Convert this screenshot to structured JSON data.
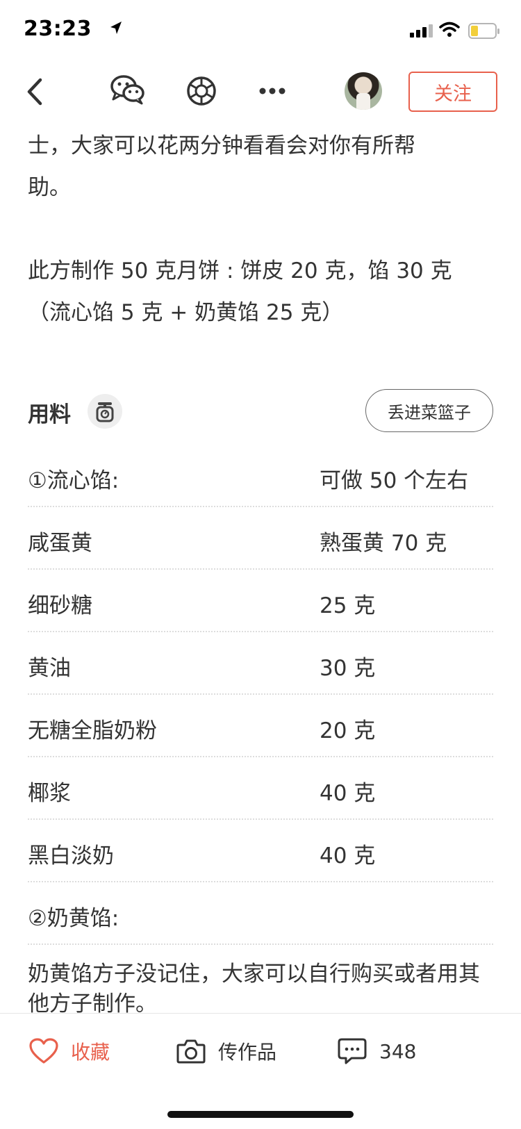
{
  "status_bar": {
    "time": "23:23"
  },
  "nav": {
    "follow_label": "关注"
  },
  "content": {
    "intro_line1": "士，大家可以花两分钟看看会对你有所帮",
    "intro_line2": "助。",
    "portion_line1": "此方制作 50 克月饼 : 饼皮 20 克，馅 30 克",
    "portion_line2": "（流心馅 5 克 + 奶黄馅 25 克）"
  },
  "ingredients": {
    "title": "用料",
    "basket_label": "丢进菜篮子",
    "rows": [
      {
        "name": "①流心馅:",
        "amount": "可做 50 个左右"
      },
      {
        "name": "咸蛋黄",
        "amount": "熟蛋黄 70 克"
      },
      {
        "name": "细砂糖",
        "amount": "25 克"
      },
      {
        "name": "黄油",
        "amount": "30 克"
      },
      {
        "name": "无糖全脂奶粉",
        "amount": "20 克"
      },
      {
        "name": "椰浆",
        "amount": "40 克"
      },
      {
        "name": "黑白淡奶",
        "amount": "40 克"
      },
      {
        "name": "②奶黄馅:",
        "amount": ""
      }
    ],
    "note": "奶黄馅方子没记住，大家可以自行购买或者用其他方子制作。"
  },
  "bottom_bar": {
    "favorite_label": "收藏",
    "upload_label": "传作品",
    "comment_count": "348"
  },
  "colors": {
    "accent": "#e8604c",
    "text": "#333333",
    "divider": "#dddddd"
  },
  "icons": [
    "location-arrow-icon",
    "signal-icon",
    "wifi-icon",
    "battery-icon",
    "back-icon",
    "wechat-icon",
    "moments-icon",
    "more-icon",
    "scale-icon",
    "heart-icon",
    "camera-icon",
    "comment-icon"
  ]
}
